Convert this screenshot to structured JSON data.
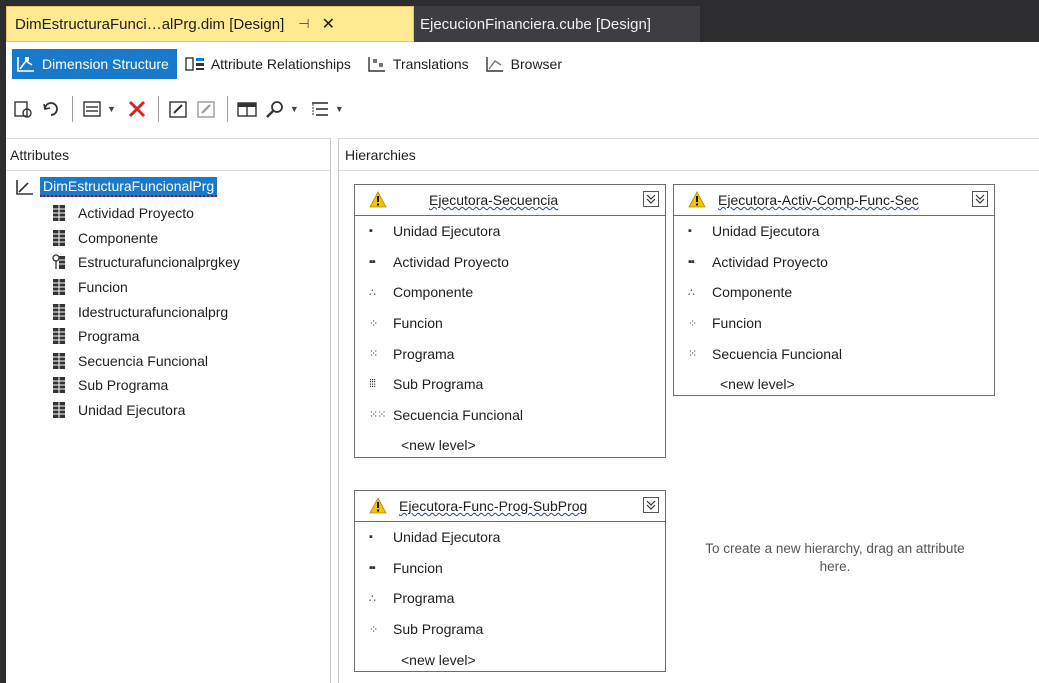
{
  "tabs": {
    "active": "DimEstructuraFunci…alPrg.dim [Design]",
    "inactive": "EjecucionFinanciera.cube [Design]"
  },
  "designer_tabs": [
    {
      "label": "Dimension Structure",
      "active": true
    },
    {
      "label": "Attribute Relationships",
      "active": false
    },
    {
      "label": "Translations",
      "active": false
    },
    {
      "label": "Browser",
      "active": false
    }
  ],
  "attributes": {
    "header": "Attributes",
    "root": "DimEstructuraFuncionalPrg",
    "items": [
      "Actividad Proyecto",
      "Componente",
      "Estructurafuncionalprgkey",
      "Funcion",
      "Idestructurafuncionalprg",
      "Programa",
      "Secuencia Funcional",
      "Sub Programa",
      "Unidad Ejecutora"
    ]
  },
  "hierarchies": {
    "header": "Hierarchies",
    "boxes": [
      {
        "name": "Ejecutora-Secuencia",
        "levels": [
          "Unidad Ejecutora",
          "Actividad Proyecto",
          "Componente",
          "Funcion",
          "Programa",
          "Sub Programa",
          "Secuencia Funcional"
        ],
        "new_level": "<new level>"
      },
      {
        "name": "Ejecutora-Activ-Comp-Func-Sec",
        "levels": [
          "Unidad Ejecutora",
          "Actividad Proyecto",
          "Componente",
          "Funcion",
          "Secuencia Funcional"
        ],
        "new_level": "<new level>"
      },
      {
        "name": "Ejecutora-Func-Prog-SubProg",
        "levels": [
          "Unidad Ejecutora",
          "Funcion",
          "Programa",
          "Sub Programa"
        ],
        "new_level": "<new level>"
      }
    ],
    "drop_hint": "To create a new hierarchy, drag an attribute here."
  },
  "colors": {
    "active_tab": "#ffe991",
    "selection": "#1979ca",
    "frame": "#2d2d30",
    "warning": "#f5c400"
  }
}
